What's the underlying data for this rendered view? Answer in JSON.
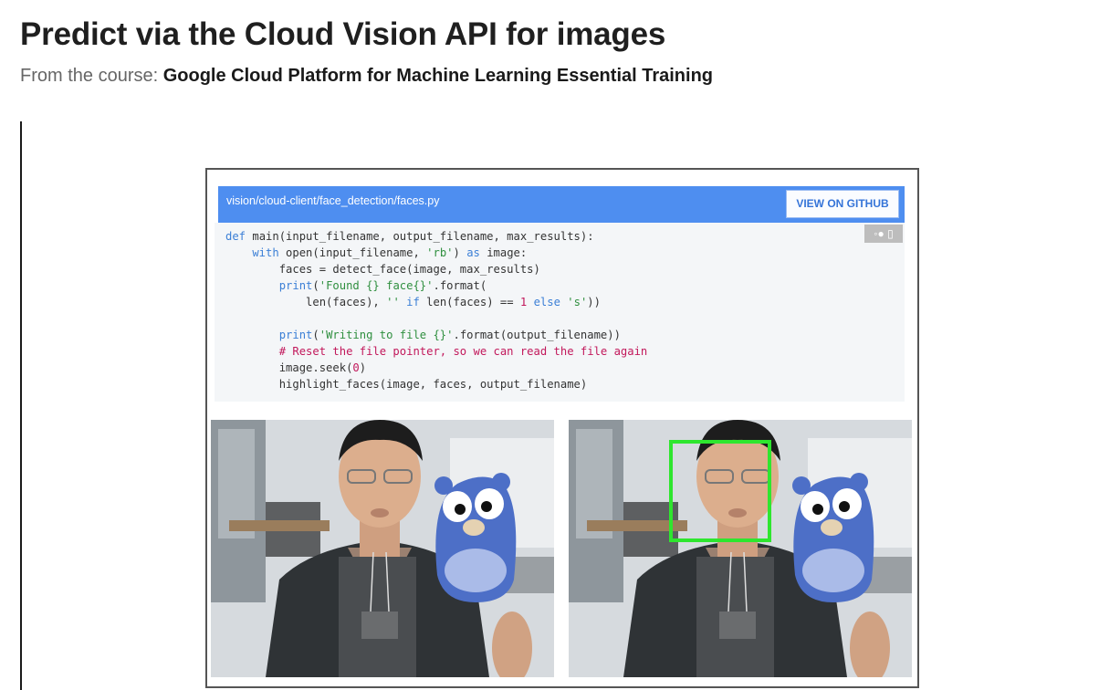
{
  "page": {
    "title": "Predict via the Cloud Vision API for images",
    "subtitle_prefix": "From the course: ",
    "course_name": "Google Cloud Platform for Machine Learning Essential Training"
  },
  "slide": {
    "file_path": "vision/cloud-client/face_detection/faces.py",
    "github_button_label": "VIEW ON GITHUB",
    "code_tools_glyph": "◦● ▯",
    "code": {
      "l1a": "def",
      "l1b": " main(input_filename, output_filename, max_results):",
      "l2a": "    with",
      "l2b": " open(input_filename, ",
      "l2c": "'rb'",
      "l2d": ") ",
      "l2e": "as",
      "l2f": " image:",
      "l3": "        faces = detect_face(image, max_results)",
      "l4a": "        print",
      "l4b": "(",
      "l4c": "'Found {} face{}'",
      "l4d": ".format(",
      "l5a": "            len(faces), ",
      "l5b": "''",
      "l5c": " ",
      "l5d": "if",
      "l5e": " len(faces) == ",
      "l5f": "1",
      "l5g": " ",
      "l5h": "else",
      "l5i": " ",
      "l5j": "'s'",
      "l5k": "))",
      "l6": "",
      "l7a": "        print",
      "l7b": "(",
      "l7c": "'Writing to file {}'",
      "l7d": ".format(output_filename))",
      "l8": "        # Reset the file pointer, so we can read the file again",
      "l9a": "        image.seek(",
      "l9b": "0",
      "l9c": ")",
      "l10": "        highlight_faces(image, faces, output_filename)"
    },
    "images": [
      {
        "name": "original-photo",
        "face_box": false
      },
      {
        "name": "face-detected-photo",
        "face_box": true,
        "box_color": "#2ee62e"
      }
    ]
  },
  "colors": {
    "header_blue": "#4e8ef0",
    "keyword": "#3b7fd6",
    "string": "#2f8f3f",
    "number_comment": "#c2185b"
  }
}
